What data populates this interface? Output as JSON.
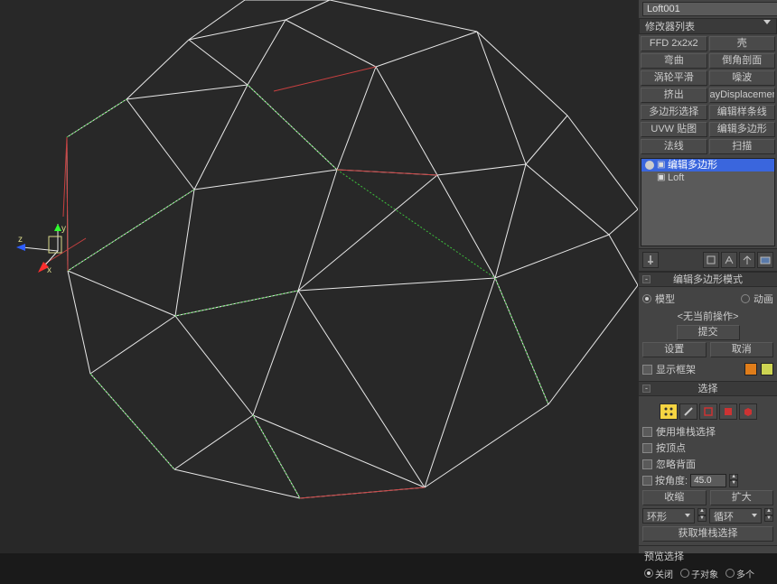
{
  "object_name": "Loft001",
  "modifier_list_label": "修改器列表",
  "modifier_buttons": [
    "FFD 2x2x2",
    "壳",
    "弯曲",
    "倒角剖面",
    "涡轮平滑",
    "噪波",
    "挤出",
    "ayDisplacementM",
    "多边形选择",
    "编辑样条线",
    "UVW 贴图",
    "编辑多边形",
    "法线",
    "扫描"
  ],
  "mod_stack": [
    {
      "label": "编辑多边形",
      "selected": true
    },
    {
      "label": "Loft",
      "selected": false
    }
  ],
  "rollout_edit_mode": {
    "title": "编辑多边形模式",
    "radio_model": "模型",
    "radio_anim": "动画",
    "noop": "<无当前操作>",
    "commit": "提交",
    "settings": "设置",
    "cancel": "取消",
    "show_cage": "显示框架",
    "cage_colors": [
      "#e07d1a",
      "#cdd452"
    ]
  },
  "rollout_selection": {
    "title": "选择",
    "use_stack": "使用堆栈选择",
    "by_vertex": "按顶点",
    "ignore_back": "忽略背面",
    "by_angle": "按角度:",
    "angle_value": "45.0",
    "shrink": "收缩",
    "grow": "扩大",
    "ring": "环形",
    "loop": "循环",
    "get_stack_sel": "获取堆栈选择"
  },
  "rollout_preview": {
    "title": "预览选择",
    "off": "关闭",
    "subobj": "子对象",
    "multi": "多个"
  },
  "axis": {
    "x": "x",
    "y": "y",
    "z": "z"
  }
}
